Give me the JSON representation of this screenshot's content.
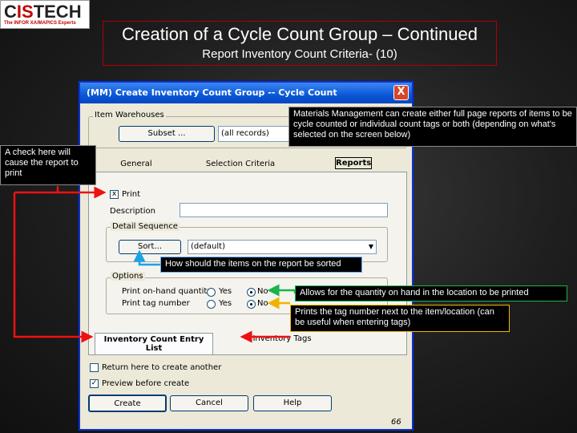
{
  "logo": {
    "name": "CISTECH",
    "tagline": "The INFOR XA/MAPICS Experts"
  },
  "slide": {
    "title": "Creation of a Cycle Count Group – Continued",
    "subtitle": "Report Inventory Count Criteria- (10)",
    "page_number": "66"
  },
  "dialog": {
    "title": "(MM) Create Inventory Count Group -- Cycle Count",
    "close": "X",
    "item_warehouses_label": "Item Warehouses",
    "subset_button": "Subset ...",
    "subset_value": "(all records)",
    "tabs": [
      "General",
      "Selection Criteria",
      "Reports"
    ],
    "print_label": "Print",
    "print_checked": "x",
    "description_label": "Description",
    "description_value": "",
    "detail_sequence_label": "Detail Sequence",
    "sort_button": "Sort...",
    "sort_value": "(default)",
    "options_label": "Options",
    "print_onhand_label": "Print on-hand quantity",
    "print_tag_label": "Print tag number",
    "yes_label": "Yes",
    "no_label": "No",
    "subtab_active": "Inventory Count Entry List",
    "subtab_other": "Inventory Tags",
    "return_label": "Return here to create another",
    "preview_label": "Preview before create",
    "preview_checked": "✓",
    "create_button": "Create",
    "cancel_button": "Cancel",
    "help_button": "Help"
  },
  "callouts": {
    "materials": "Materials Management can create either full page reports of items to be cycle counted or individual count tags or both (depending on what's selected on the screen below)",
    "check": "A check here will cause the report to print",
    "sort": "How should the items on the report be sorted",
    "onhand": "Allows for the quantity on hand in the location to be printed",
    "tag": "Prints the tag number next to the item/location (can be useful when entering tags)"
  },
  "colors": {
    "red_arrow": "#ee1111",
    "blue_arrow": "#1aa3e8",
    "green_arrow": "#19b548",
    "yellow_arrow": "#f0b400"
  }
}
